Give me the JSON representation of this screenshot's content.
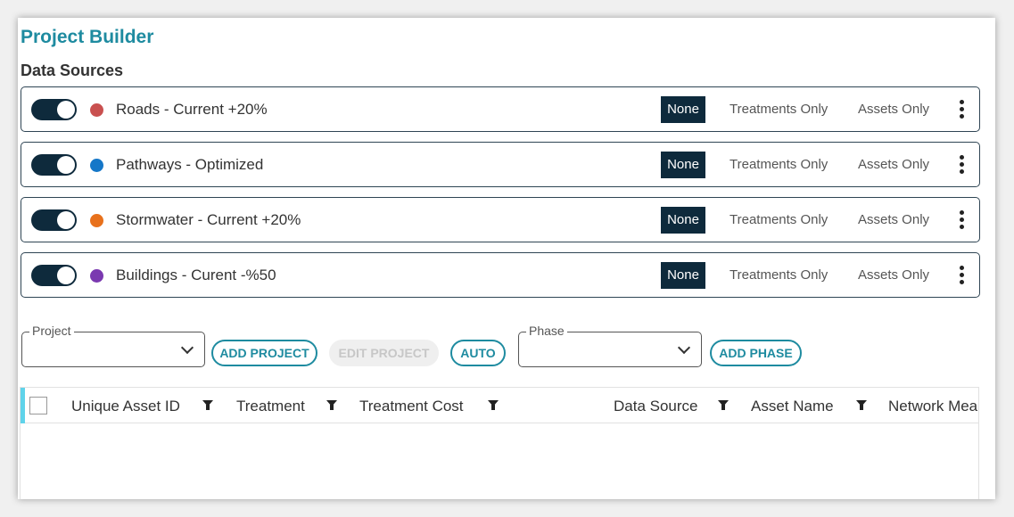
{
  "header": {
    "title": "Project Builder",
    "section_title": "Data Sources"
  },
  "data_sources": [
    {
      "label": "Roads - Current +20%",
      "color": "#c9504f",
      "enabled": true
    },
    {
      "label": "Pathways - Optimized",
      "color": "#1577c8",
      "enabled": true
    },
    {
      "label": "Stormwater - Current +20%",
      "color": "#e8711c",
      "enabled": true
    },
    {
      "label": "Buildings - Curent -%50",
      "color": "#7a39b0",
      "enabled": true
    }
  ],
  "source_options": {
    "none": "None",
    "treatments_only": "Treatments Only",
    "assets_only": "Assets Only",
    "selected": "None"
  },
  "controls": {
    "project_label": "Project",
    "project_value": "",
    "add_project": "ADD PROJECT",
    "edit_project": "EDIT PROJECT",
    "auto": "AUTO",
    "phase_label": "Phase",
    "phase_value": "",
    "add_phase": "ADD PHASE"
  },
  "grid": {
    "columns": [
      "Unique Asset ID",
      "Treatment",
      "Treatment Cost",
      "Data Source",
      "Asset Name",
      "Network Mea"
    ],
    "rows": []
  },
  "colors": {
    "accent": "#1e8ba0",
    "dark": "#0e2a3c"
  }
}
